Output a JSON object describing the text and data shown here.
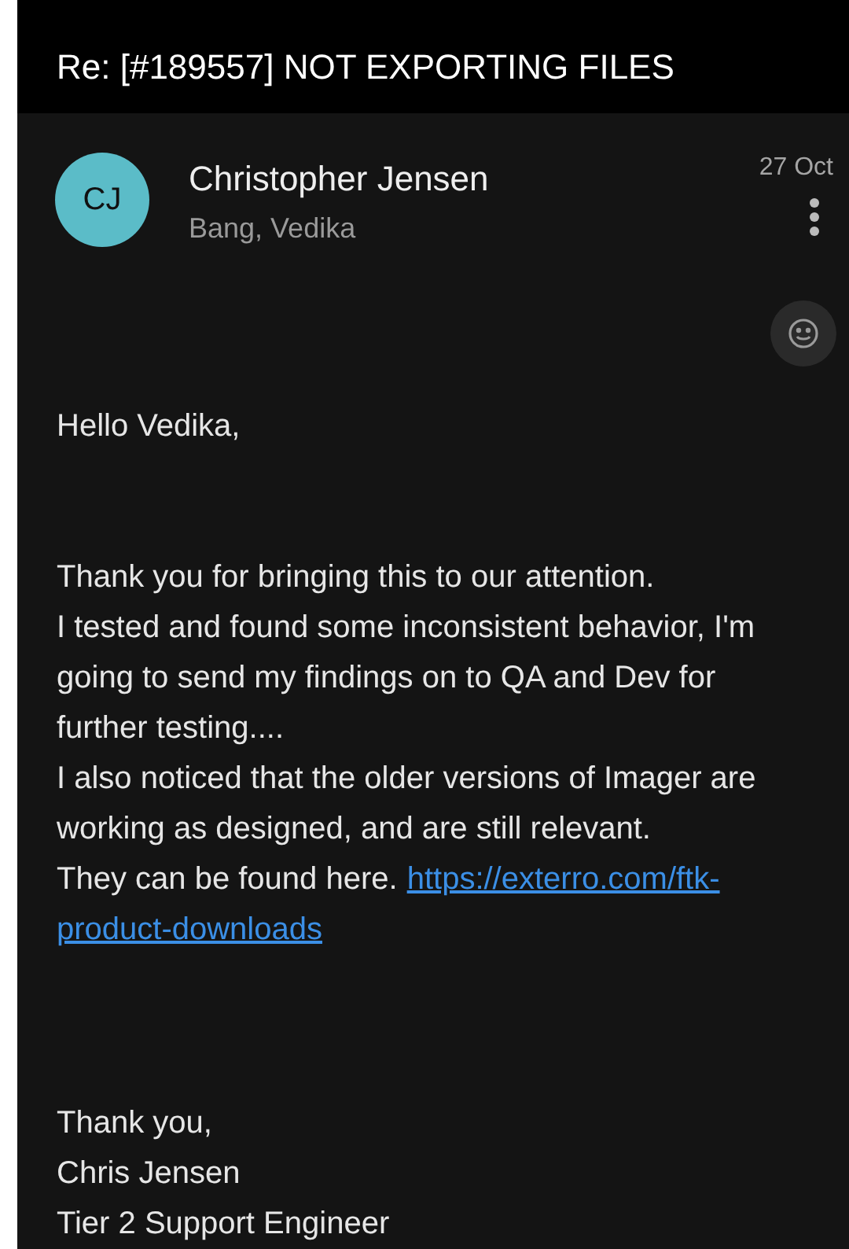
{
  "header": {
    "title": "Re: [#189557] NOT EXPORTING FILES"
  },
  "message": {
    "initials": "CJ",
    "sender": "Christopher Jensen",
    "recipients": "Bang, Vedika",
    "date": "27 Oct"
  },
  "body": {
    "greeting": "Hello Vedika,",
    "lines": [
      "Thank you for bringing this to our attention.",
      "I tested and found some inconsistent behavior, I'm going to send my findings on to QA and Dev for further testing....",
      "I also noticed that the older versions of Imager are working as designed, and are still relevant."
    ],
    "link_line": {
      "text": "They can be found here.",
      "link_parts": [
        "https://exterro.com/ftk-",
        "product-downloads"
      ]
    },
    "signature": [
      "Thank you,",
      "Chris Jensen",
      "Tier 2 Support Engineer"
    ]
  }
}
